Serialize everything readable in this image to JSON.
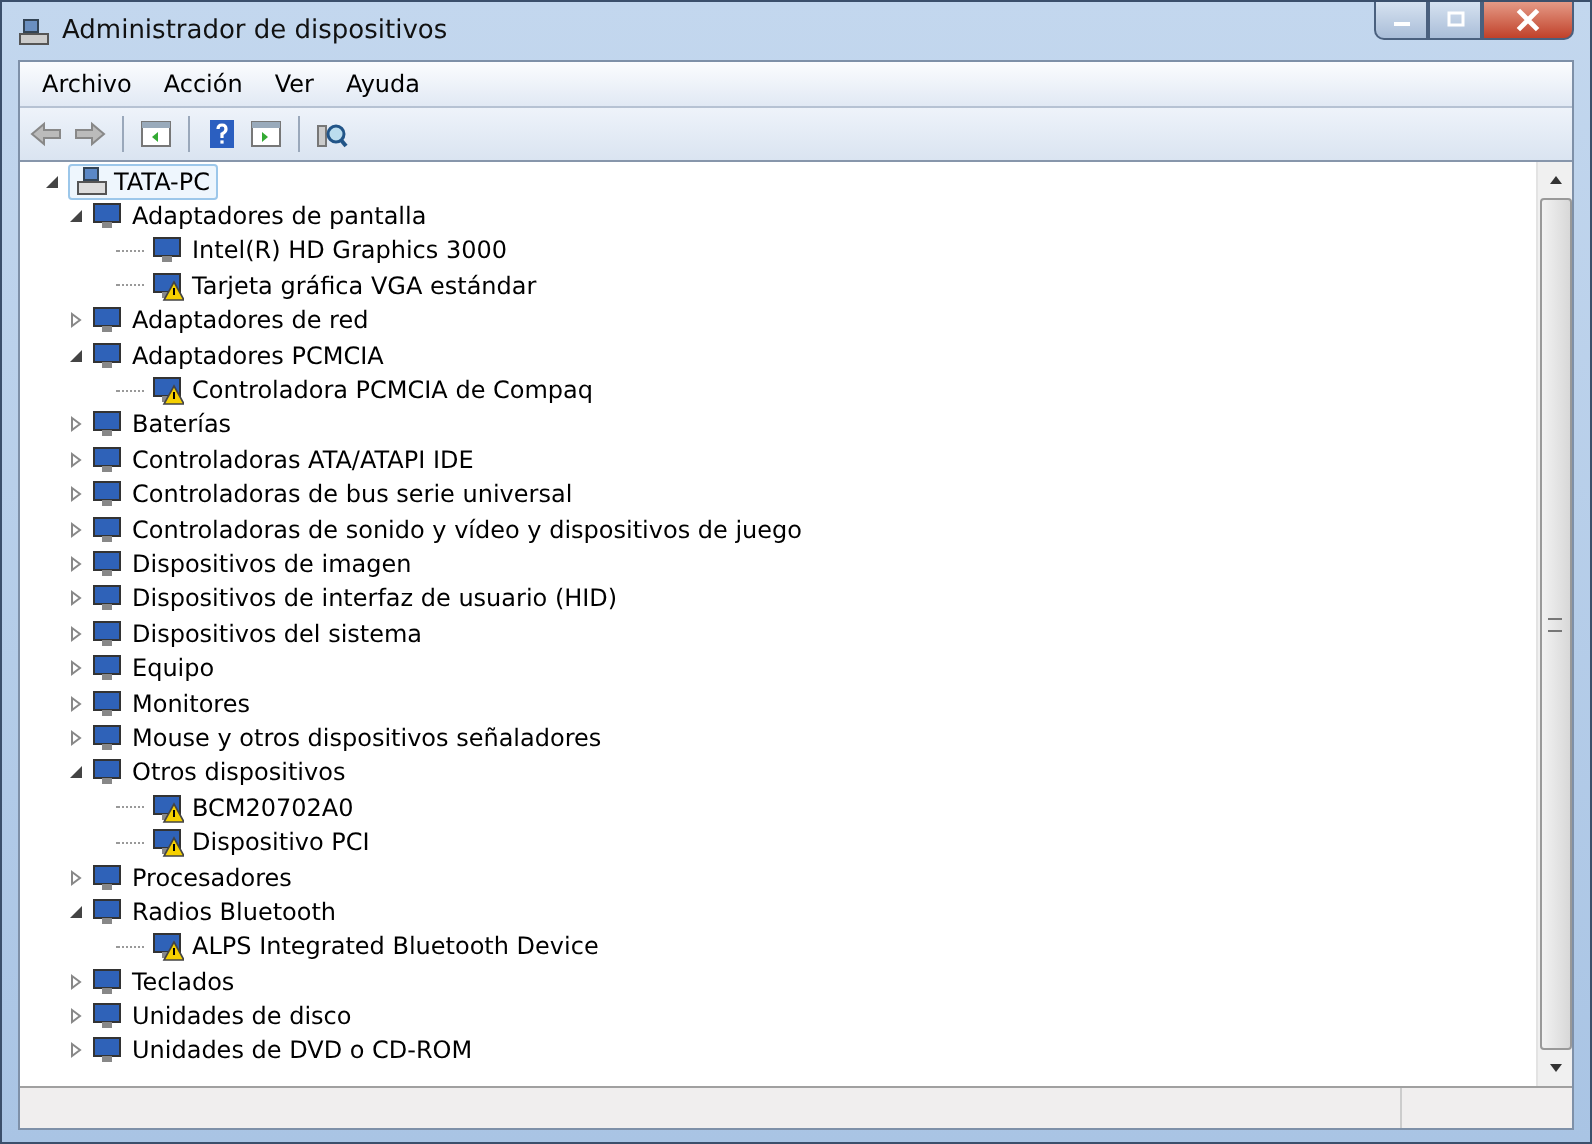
{
  "window": {
    "title": "Administrador de dispositivos"
  },
  "menu": [
    "Archivo",
    "Acción",
    "Ver",
    "Ayuda"
  ],
  "tree": {
    "label": "TATA-PC",
    "expanded": true,
    "selected": true,
    "children": [
      {
        "label": "Adaptadores de pantalla",
        "expanded": true,
        "children": [
          {
            "label": "Intel(R) HD Graphics 3000",
            "warning": false
          },
          {
            "label": "Tarjeta gráfica VGA estándar",
            "warning": true
          }
        ]
      },
      {
        "label": "Adaptadores de red",
        "expanded": false
      },
      {
        "label": "Adaptadores PCMCIA",
        "expanded": true,
        "children": [
          {
            "label": "Controladora PCMCIA de Compaq",
            "warning": true
          }
        ]
      },
      {
        "label": "Baterías",
        "expanded": false
      },
      {
        "label": "Controladoras ATA/ATAPI IDE",
        "expanded": false
      },
      {
        "label": "Controladoras de bus serie universal",
        "expanded": false
      },
      {
        "label": "Controladoras de sonido y vídeo y dispositivos de juego",
        "expanded": false
      },
      {
        "label": "Dispositivos de imagen",
        "expanded": false
      },
      {
        "label": "Dispositivos de interfaz de usuario (HID)",
        "expanded": false
      },
      {
        "label": "Dispositivos del sistema",
        "expanded": false
      },
      {
        "label": "Equipo",
        "expanded": false
      },
      {
        "label": "Monitores",
        "expanded": false
      },
      {
        "label": "Mouse y otros dispositivos señaladores",
        "expanded": false
      },
      {
        "label": "Otros dispositivos",
        "expanded": true,
        "children": [
          {
            "label": "BCM20702A0",
            "warning": true
          },
          {
            "label": "Dispositivo PCI",
            "warning": true
          }
        ]
      },
      {
        "label": "Procesadores",
        "expanded": false
      },
      {
        "label": "Radios Bluetooth",
        "expanded": true,
        "children": [
          {
            "label": "ALPS Integrated Bluetooth Device",
            "warning": true
          }
        ]
      },
      {
        "label": "Teclados",
        "expanded": false
      },
      {
        "label": "Unidades de disco",
        "expanded": false
      },
      {
        "label": "Unidades de DVD o CD-ROM",
        "expanded": false
      }
    ]
  }
}
